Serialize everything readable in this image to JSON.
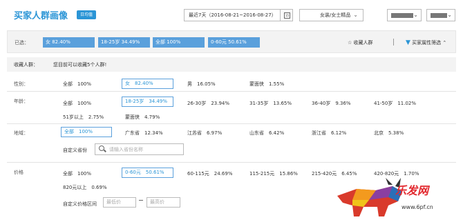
{
  "header": {
    "title": "买家人群画像",
    "badge": "日均值",
    "date_range": "最近7天（2016-08-21~2016-08-27）",
    "calendar_glyph": "15",
    "category": "女装/女士精品"
  },
  "selected": {
    "label": "已选：",
    "chips": [
      "女 82.40%",
      "18-25岁 34.49%",
      "全部 100%",
      "0-60元 50.61%"
    ],
    "fav_label": "收藏人群",
    "filter_label": "买家属性筛选"
  },
  "favorites": {
    "label": "收藏人群：",
    "text": "您目前可以收藏5个人群!"
  },
  "gender": {
    "label": "性别：",
    "options": [
      "全部　100%",
      "女　82.40%",
      "男　16.05%",
      "蒙面侠　1.55%"
    ]
  },
  "age": {
    "label": "年龄：",
    "options": [
      "全部　100%",
      "18-25岁　34.49%",
      "26-30岁　23.94%",
      "31-35岁　13.65%",
      "36-40岁　9.36%",
      "41-50岁　11.02%",
      "51岁以上　2.75%",
      "蒙面侠　4.79%"
    ]
  },
  "region": {
    "label": "地域：",
    "options": [
      "全部　100%",
      "广东省　12.34%",
      "江苏省　6.97%",
      "山东省　6.42%",
      "浙江省　6.12%",
      "北京　5.38%"
    ],
    "custom_label": "自定义省份",
    "placeholder": "请输入省份名称"
  },
  "price": {
    "label": "价格",
    "options": [
      "全部　100%",
      "0-60元　50.61%",
      "60-115元　24.69%",
      "115-215元　15.86%",
      "215-420元　6.45%",
      "420-820元　1.70%",
      "820元以上　0.69%"
    ],
    "custom_label": "自定义价格区间",
    "min_placeholder": "最低价",
    "max_placeholder": "最高价"
  },
  "watermark": {
    "text": "乐发网",
    "url": "www.6pf.cn"
  },
  "colors": {
    "accent": "#2b95d6",
    "chip": "#5aa0dc",
    "watermark_red": "#e2282e"
  }
}
